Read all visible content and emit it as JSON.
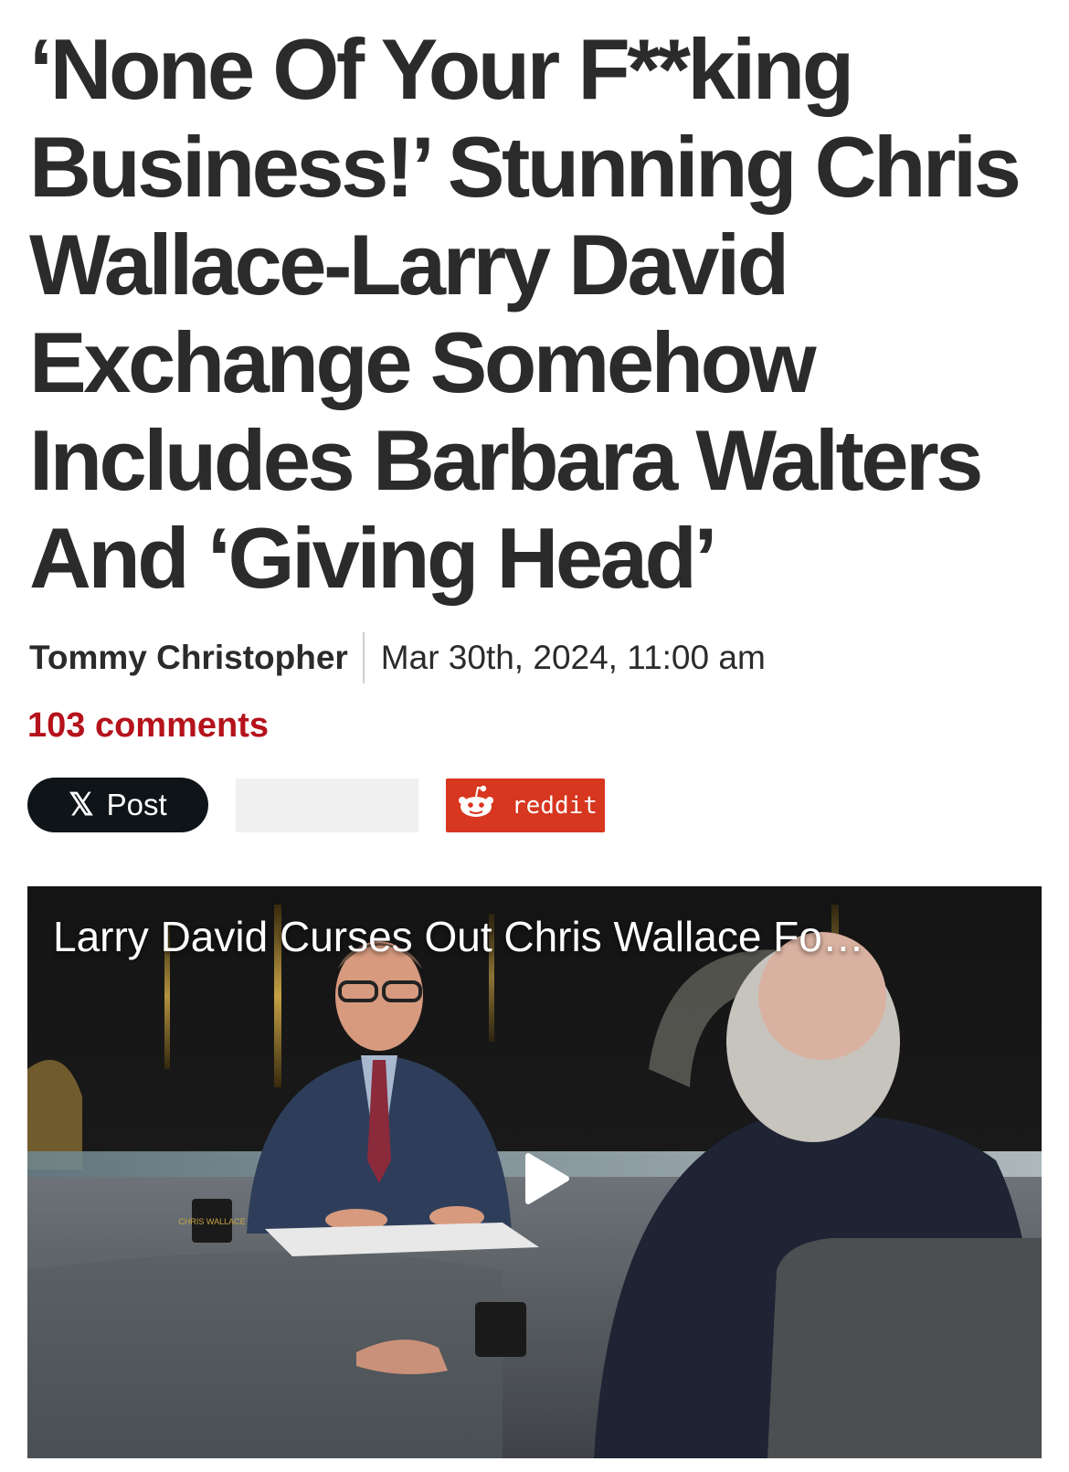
{
  "article": {
    "headline": "‘None Of Your F**king Business!’ Stunning Chris Wallace-Larry David Exchange Somehow Includes Barbara Walters And ‘Giving Head’",
    "author": "Tommy Christopher",
    "date": "Mar 30th, 2024, 11:00 am",
    "comments": "103 comments"
  },
  "share": {
    "x_post_label": "Post",
    "reddit_label": "reddit"
  },
  "video": {
    "title": "Larry David Curses Out Chris Wallace Fo…",
    "mug_text": "CHRIS WALLACE"
  },
  "colors": {
    "accent_red": "#b5121b",
    "reddit_orange": "#d7361f",
    "x_black": "#0f1419"
  }
}
